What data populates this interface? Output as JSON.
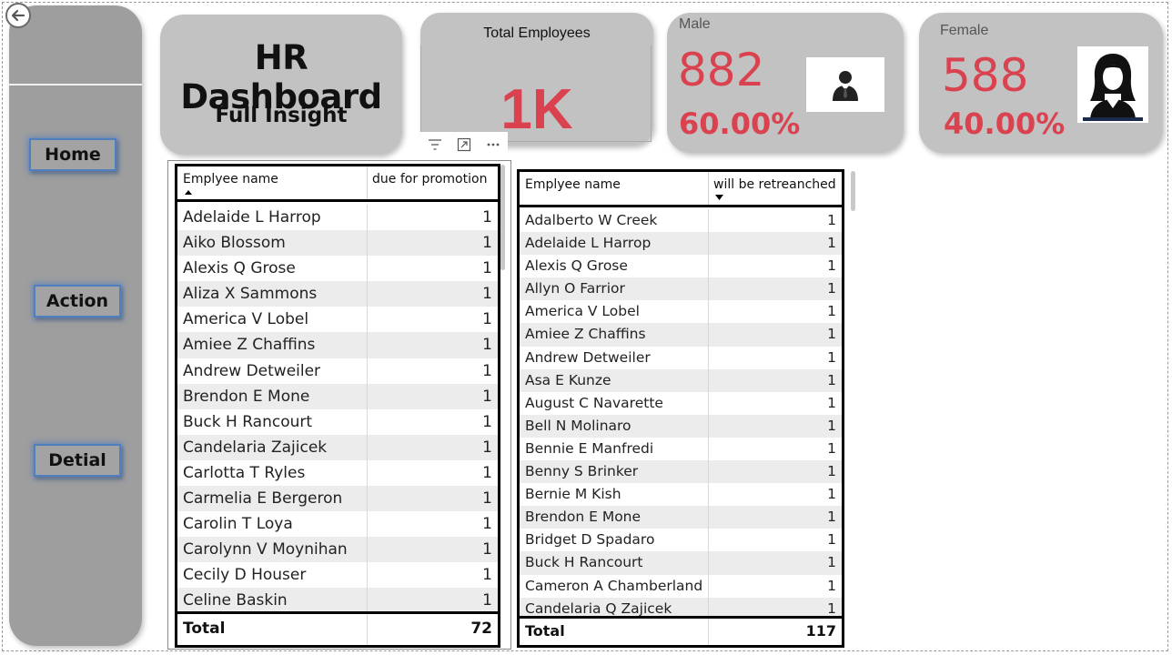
{
  "sidebar": {
    "nav": [
      {
        "label": "Home"
      },
      {
        "label": "Action"
      },
      {
        "label": "Detial"
      }
    ]
  },
  "header": {
    "title": "HR Dashboard",
    "subtitle": "Full Insight"
  },
  "kpis": {
    "total_employees": {
      "label": "Total Employees",
      "value": "1K"
    },
    "male": {
      "label": "Male",
      "count": "882",
      "percent": "60.00%",
      "icon": "male-avatar-icon"
    },
    "female": {
      "label": "Female",
      "count": "588",
      "percent": "40.00%",
      "icon": "female-avatar-icon"
    }
  },
  "colors": {
    "accent_red": "#d9424e",
    "card_gray": "#c2c2c2",
    "sidebar_gray": "#9e9e9e",
    "nav_glow": "#4f7fbf"
  },
  "promotion_table": {
    "columns": [
      "Emplyee name",
      "due for promotion"
    ],
    "sort": "ascending-by-name",
    "rows": [
      {
        "name": "Adelaide L Harrop",
        "value": "1"
      },
      {
        "name": "Aiko Blossom",
        "value": "1"
      },
      {
        "name": "Alexis Q Grose",
        "value": "1"
      },
      {
        "name": "Aliza X Sammons",
        "value": "1"
      },
      {
        "name": "America V Lobel",
        "value": "1"
      },
      {
        "name": "Amiee Z Chaffins",
        "value": "1"
      },
      {
        "name": "Andrew Detweiler",
        "value": "1"
      },
      {
        "name": "Brendon E Mone",
        "value": "1"
      },
      {
        "name": "Buck H Rancourt",
        "value": "1"
      },
      {
        "name": "Candelaria Zajicek",
        "value": "1"
      },
      {
        "name": "Carlotta T Ryles",
        "value": "1"
      },
      {
        "name": "Carmelia E Bergeron",
        "value": "1"
      },
      {
        "name": "Carolin T Loya",
        "value": "1"
      },
      {
        "name": "Carolynn V Moynihan",
        "value": "1"
      },
      {
        "name": "Cecily D Houser",
        "value": "1"
      },
      {
        "name": "Celine Baskin",
        "value": "1"
      }
    ],
    "total_label": "Total",
    "total_value": "72"
  },
  "retrench_table": {
    "columns": [
      "Emplyee name",
      "will be retreanched"
    ],
    "sort": "descending-by-value",
    "rows": [
      {
        "name": "Adalberto W Creek",
        "value": "1"
      },
      {
        "name": "Adelaide L Harrop",
        "value": "1"
      },
      {
        "name": "Alexis Q Grose",
        "value": "1"
      },
      {
        "name": "Allyn O Farrior",
        "value": "1"
      },
      {
        "name": "America V Lobel",
        "value": "1"
      },
      {
        "name": "Amiee Z Chaffins",
        "value": "1"
      },
      {
        "name": "Andrew Detweiler",
        "value": "1"
      },
      {
        "name": "Asa E Kunze",
        "value": "1"
      },
      {
        "name": "August C Navarette",
        "value": "1"
      },
      {
        "name": "Bell N Molinaro",
        "value": "1"
      },
      {
        "name": "Bennie E Manfredi",
        "value": "1"
      },
      {
        "name": "Benny S Brinker",
        "value": "1"
      },
      {
        "name": "Bernie M Kish",
        "value": "1"
      },
      {
        "name": "Brendon E Mone",
        "value": "1"
      },
      {
        "name": "Bridget D Spadaro",
        "value": "1"
      },
      {
        "name": "Buck H Rancourt",
        "value": "1"
      },
      {
        "name": "Cameron A Chamberland",
        "value": "1"
      },
      {
        "name": "Candelaria Q Zajicek",
        "value": "1"
      }
    ],
    "total_label": "Total",
    "total_value": "117"
  }
}
